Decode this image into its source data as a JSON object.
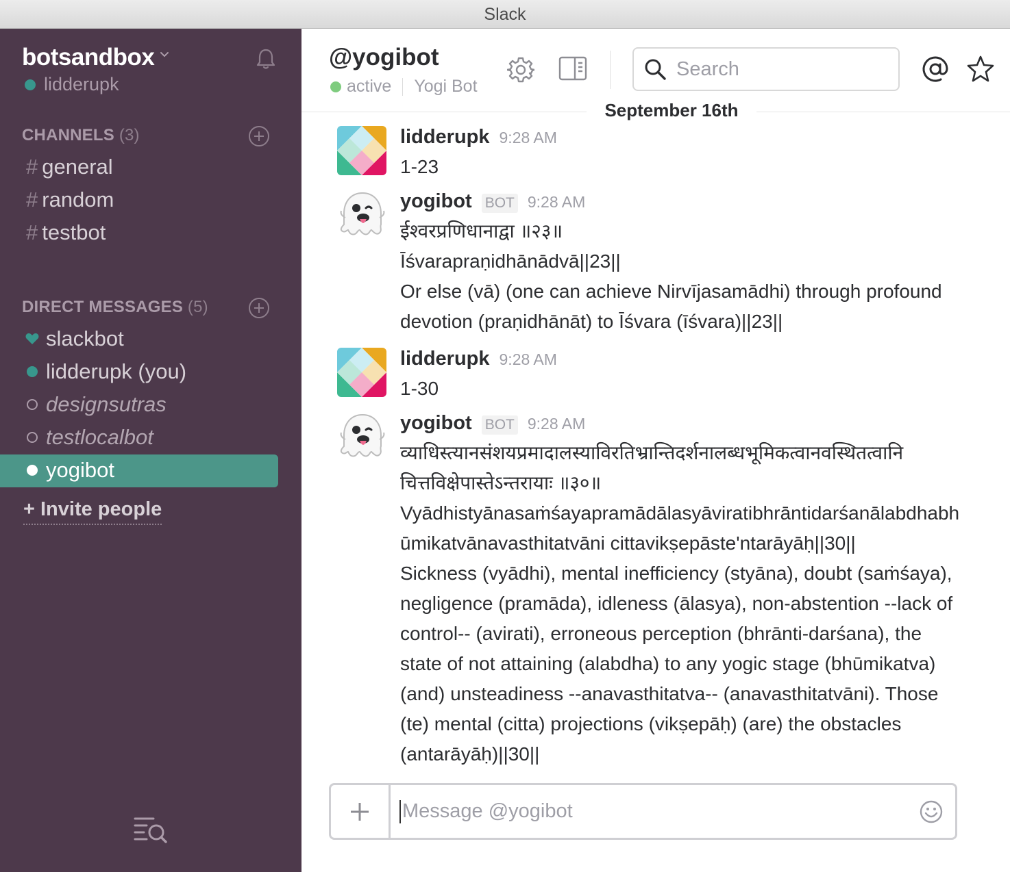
{
  "window": {
    "title": "Slack"
  },
  "sidebar": {
    "team_name": "botsandbox",
    "user": "lidderupk",
    "channels_header": "CHANNELS",
    "channels_count": "(3)",
    "channels": [
      {
        "name": "general"
      },
      {
        "name": "random"
      },
      {
        "name": "testbot"
      }
    ],
    "dm_header": "DIRECT MESSAGES",
    "dm_count": "(5)",
    "dms": [
      {
        "name": "slackbot",
        "status": "heart"
      },
      {
        "name": "lidderupk (you)",
        "status": "online"
      },
      {
        "name": "designsutras",
        "status": "away"
      },
      {
        "name": "testlocalbot",
        "status": "away"
      },
      {
        "name": "yogibot",
        "status": "active"
      }
    ],
    "invite_label": "Invite people",
    "hash_symbol": "#",
    "plus_symbol": "+"
  },
  "header": {
    "channel_name": "@yogibot",
    "presence": "active",
    "full_name": "Yogi Bot",
    "search_placeholder": "Search"
  },
  "date_divider": "September 16th",
  "messages": [
    {
      "author": "lidderupk",
      "time": "9:28 AM",
      "bot": false,
      "lines": [
        "1-23"
      ]
    },
    {
      "author": "yogibot",
      "bot_tag": "BOT",
      "time": "9:28 AM",
      "bot": true,
      "lines": [
        "ईश्वरप्रणिधानाद्वा ॥२३॥",
        "Īśvarapraṇidhānādvā||23||",
        "Or else (vā) (one can achieve Nirvījasamādhi) through profound",
        "devotion (praṇidhānāt) to Īśvara (īśvara)||23||"
      ]
    },
    {
      "author": "lidderupk",
      "time": "9:28 AM",
      "bot": false,
      "lines": [
        "1-30"
      ]
    },
    {
      "author": "yogibot",
      "bot_tag": "BOT",
      "time": "9:28 AM",
      "bot": true,
      "lines": [
        "व्याधिस्त्यानसंशयप्रमादालस्याविरतिभ्रान्तिदर्शनालब्धभूमिकत्वानवस्थितत्वानि",
        "चित्तविक्षेपास्तेऽन्तरायाः ॥३०॥",
        "Vyādhistyānasaṁśayapramādālasyāviratibhrāntidarśanālabdhabh",
        "ūmikatvānavasthitatvāni cittavikṣepāste'ntarāyāḥ||30||",
        "Sickness (vyādhi), mental inefficiency (styāna), doubt (saṁśaya),",
        "negligence (pramāda), idleness (ālasya), non-abstention --lack of",
        "control-- (avirati), erroneous perception (bhrānti-darśana), the",
        "state of not attaining (alabdha) to any yogic stage (bhūmikatva)",
        "(and) unsteadiness --anavasthitatva-- (anavasthitatvāni). Those",
        "(te) mental (citta) projections (vikṣepāḥ) (are) the obstacles",
        "(antarāyāḥ)||30||"
      ]
    }
  ],
  "composer": {
    "placeholder": "Message @yogibot"
  },
  "colors": {
    "sidebar": "#4d394b",
    "active_item": "#4c9689",
    "presence": "#38978d"
  }
}
